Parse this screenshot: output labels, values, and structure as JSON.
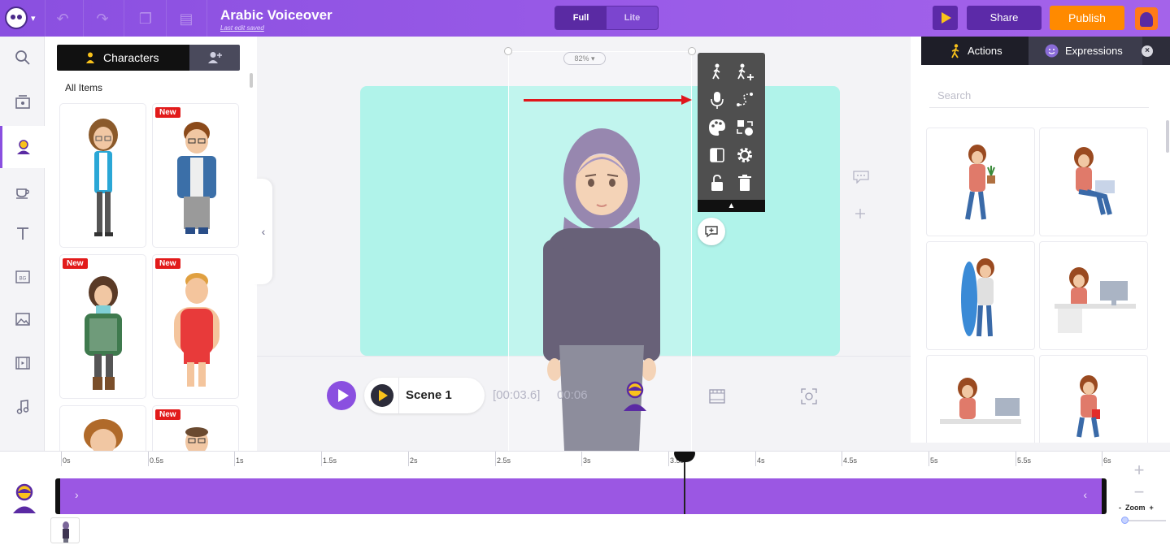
{
  "header": {
    "project_title": "Arabic Voiceover",
    "save_status": "Last edit saved",
    "mode_full": "Full",
    "mode_lite": "Lite",
    "share_label": "Share",
    "publish_label": "Publish"
  },
  "library": {
    "tab_characters": "Characters",
    "heading": "All Items",
    "new_badge": "New"
  },
  "stage": {
    "zoom": "82%",
    "scene_name": "Scene 1",
    "current_time": "[00:03.6]",
    "total_time": "00:06",
    "canvas_color": "#b0f3ea"
  },
  "right_panel": {
    "tab_actions": "Actions",
    "tab_expressions": "Expressions",
    "search_placeholder": "Search"
  },
  "timeline": {
    "ticks": [
      "0s",
      "0.5s",
      "1s",
      "1.5s",
      "2s",
      "2.5s",
      "3s",
      "3.5s",
      "4s",
      "4.5s",
      "5s",
      "5.5s",
      "6s"
    ],
    "zoom_label": "Zoom",
    "zoom_minus": "-",
    "zoom_plus": "+",
    "track_color": "#9b57e3",
    "playhead_time_s": 3.6
  },
  "colors": {
    "brand": "#8a4fe0",
    "publish": "#ff8a00",
    "new_badge": "#e21b1b",
    "arrow": "#e0161b"
  }
}
